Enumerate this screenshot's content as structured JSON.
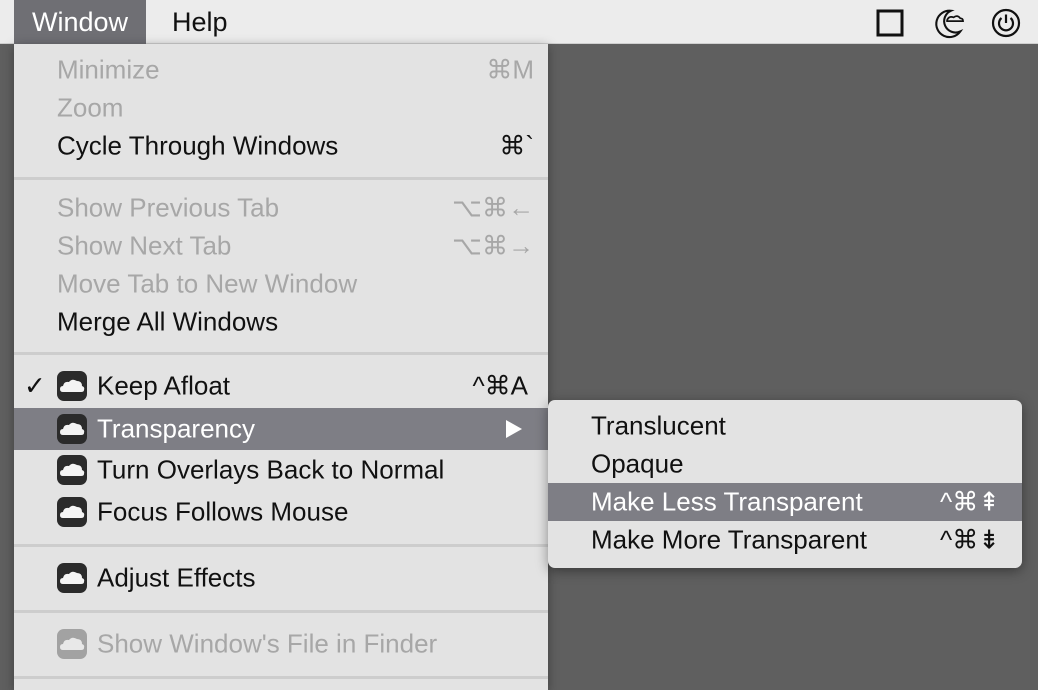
{
  "menubar": {
    "items": [
      {
        "label": "Window",
        "active": true
      },
      {
        "label": "Help",
        "active": false
      }
    ],
    "status_icons": [
      "square-icon",
      "moon-cloud-icon",
      "power-icon"
    ]
  },
  "menu": {
    "items": [
      {
        "label": "Minimize",
        "shortcut": "⌘M",
        "disabled": true
      },
      {
        "label": "Zoom",
        "shortcut": "",
        "disabled": true
      },
      {
        "label": "Cycle Through Windows",
        "shortcut": "⌘`",
        "disabled": false
      },
      {
        "label": "Show Previous Tab",
        "shortcut": "⌥⌘←",
        "disabled": true
      },
      {
        "label": "Show Next Tab",
        "shortcut": "⌥⌘→",
        "disabled": true
      },
      {
        "label": "Move Tab to New Window",
        "shortcut": "",
        "disabled": true
      },
      {
        "label": "Merge All Windows",
        "shortcut": "",
        "disabled": false
      },
      {
        "label": "Keep Afloat",
        "shortcut": "^⌘A",
        "checked": true,
        "icon": "cloud-icon"
      },
      {
        "label": "Transparency",
        "icon": "cloud-icon",
        "highlighted": true,
        "submenu": true
      },
      {
        "label": "Turn Overlays Back to Normal",
        "icon": "cloud-icon"
      },
      {
        "label": "Focus Follows Mouse",
        "icon": "cloud-icon"
      },
      {
        "label": "Adjust Effects",
        "icon": "cloud-icon"
      },
      {
        "label": "Show Window's File in Finder",
        "icon": "cloud-icon",
        "disabled": true
      }
    ]
  },
  "submenu": {
    "items": [
      {
        "label": "Translucent",
        "shortcut": ""
      },
      {
        "label": "Opaque",
        "shortcut": ""
      },
      {
        "label": "Make Less Transparent",
        "shortcut": "^⌘⇞",
        "highlighted": true
      },
      {
        "label": "Make More Transparent",
        "shortcut": "^⌘⇟"
      }
    ]
  },
  "colors": {
    "background": "#5f5f5f",
    "menu_bg": "#e3e3e3",
    "highlight": "#7e7e85",
    "disabled_text": "#a7a7a7"
  }
}
